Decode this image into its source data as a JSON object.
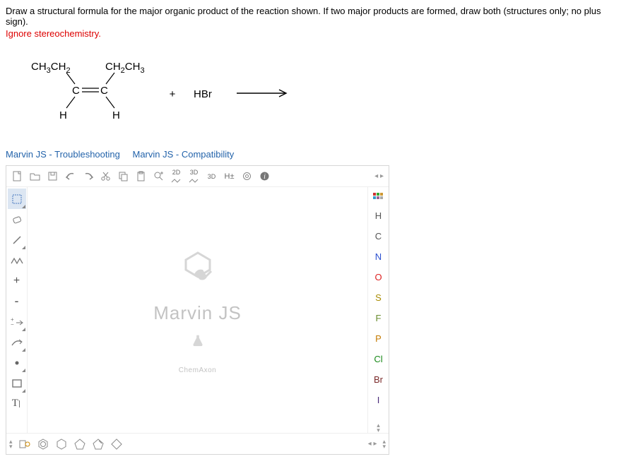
{
  "question": "Draw a structural formula for the major organic product of the reaction shown. If two major products are formed, draw both (structures only; no plus sign).",
  "instruction": "Ignore stereochemistry.",
  "reaction": {
    "reagent1_tl": "CH",
    "reagent1_tl_sub1": "3",
    "reagent1_tl2": "CH",
    "reagent1_tl_sub2": "2",
    "reagent1_tr": "CH",
    "reagent1_tr_sub1": "2",
    "reagent1_tr2": "CH",
    "reagent1_tr_sub2": "3",
    "reagent1_bond": "C",
    "reagent1_bond2": "C",
    "reagent1_bl": "H",
    "reagent1_br": "H",
    "plus": "+",
    "reagent2": "HBr"
  },
  "links": {
    "troubleshoot": "Marvin JS - Troubleshooting",
    "compat": "Marvin JS - Compatibility"
  },
  "marvin": {
    "top": {
      "scroll": "◂ ▸",
      "t2d": "2D",
      "t3d": "3D",
      "t3dr": "3D",
      "hpm": "H±"
    },
    "left": {},
    "right": {
      "periodic": "⋮⋮⋮",
      "H": "H",
      "C": "C",
      "N": "N",
      "O": "O",
      "S": "S",
      "F": "F",
      "P": "P",
      "Cl": "Cl",
      "Br": "Br",
      "I": "I"
    },
    "bottom": {
      "scroll": "◂ ▸"
    },
    "canvas": {
      "title": "Marvin JS",
      "brand": "ChemAxon"
    }
  }
}
